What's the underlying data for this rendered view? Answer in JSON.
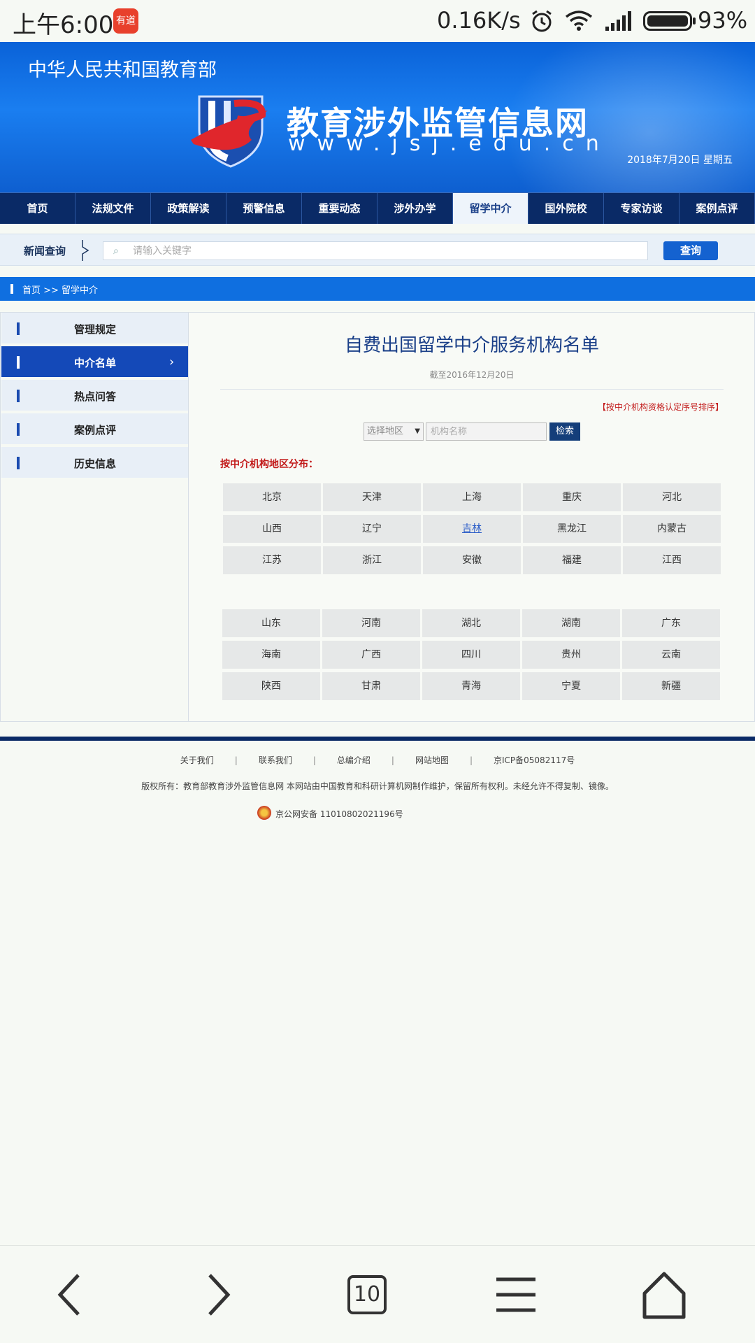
{
  "status_bar": {
    "time": "上午6:00",
    "app_icon_label": "有道",
    "speed": "0.16K/s",
    "battery_pct": "93%"
  },
  "banner": {
    "ministry": "中华人民共和国教育部",
    "site_name": "教育涉外监管信息网",
    "site_url": "www.jsj.edu.cn",
    "date": "2018年7月20日 星期五"
  },
  "nav": {
    "items": [
      "首页",
      "法规文件",
      "政策解读",
      "预警信息",
      "重要动态",
      "涉外办学",
      "留学中介",
      "国外院校",
      "专家访谈",
      "案例点评"
    ],
    "active": "留学中介"
  },
  "news_search": {
    "label": "新闻查询",
    "placeholder": "请输入关键字",
    "button": "查询"
  },
  "breadcrumb": "首页 >> 留学中介",
  "sidebar": {
    "items": [
      "管理规定",
      "中介名单",
      "热点问答",
      "案例点评",
      "历史信息"
    ],
    "active": "中介名单"
  },
  "content": {
    "title": "自费出国留学中介服务机构名单",
    "subtitle": "截至2016年12月20日",
    "sort_link": "【按中介机构资格认定序号排序】",
    "region_select": "选择地区",
    "org_placeholder": "机构名称",
    "search_button": "检索",
    "distribution_heading": "按中介机构地区分布：",
    "regions_group1": [
      "北京",
      "天津",
      "上海",
      "重庆",
      "河北",
      "山西",
      "辽宁",
      "吉林",
      "黑龙江",
      "内蒙古",
      "江苏",
      "浙江",
      "安徽",
      "福建",
      "江西"
    ],
    "regions_group2": [
      "山东",
      "河南",
      "湖北",
      "湖南",
      "广东",
      "海南",
      "广西",
      "四川",
      "贵州",
      "云南",
      "陕西",
      "甘肃",
      "青海",
      "宁夏",
      "新疆"
    ],
    "linked_region": "吉林"
  },
  "footer": {
    "links": [
      "关于我们",
      "联系我们",
      "总编介绍",
      "网站地图",
      "京ICP备05082117号"
    ],
    "copyright": "版权所有：教育部教育涉外监管信息网 本网站由中国教育和科研计算机网制作维护，保留所有权利。未经允许不得复制、镜像。",
    "police_record": "京公网安备 11010802021196号"
  },
  "browser_toolbar": {
    "tab_count": "10"
  },
  "colors": {
    "nav_bg": "#0a2a66",
    "accent_blue": "#0f6fe0",
    "sidebar_active": "#1449b8",
    "warning_red": "#c21a1a"
  }
}
